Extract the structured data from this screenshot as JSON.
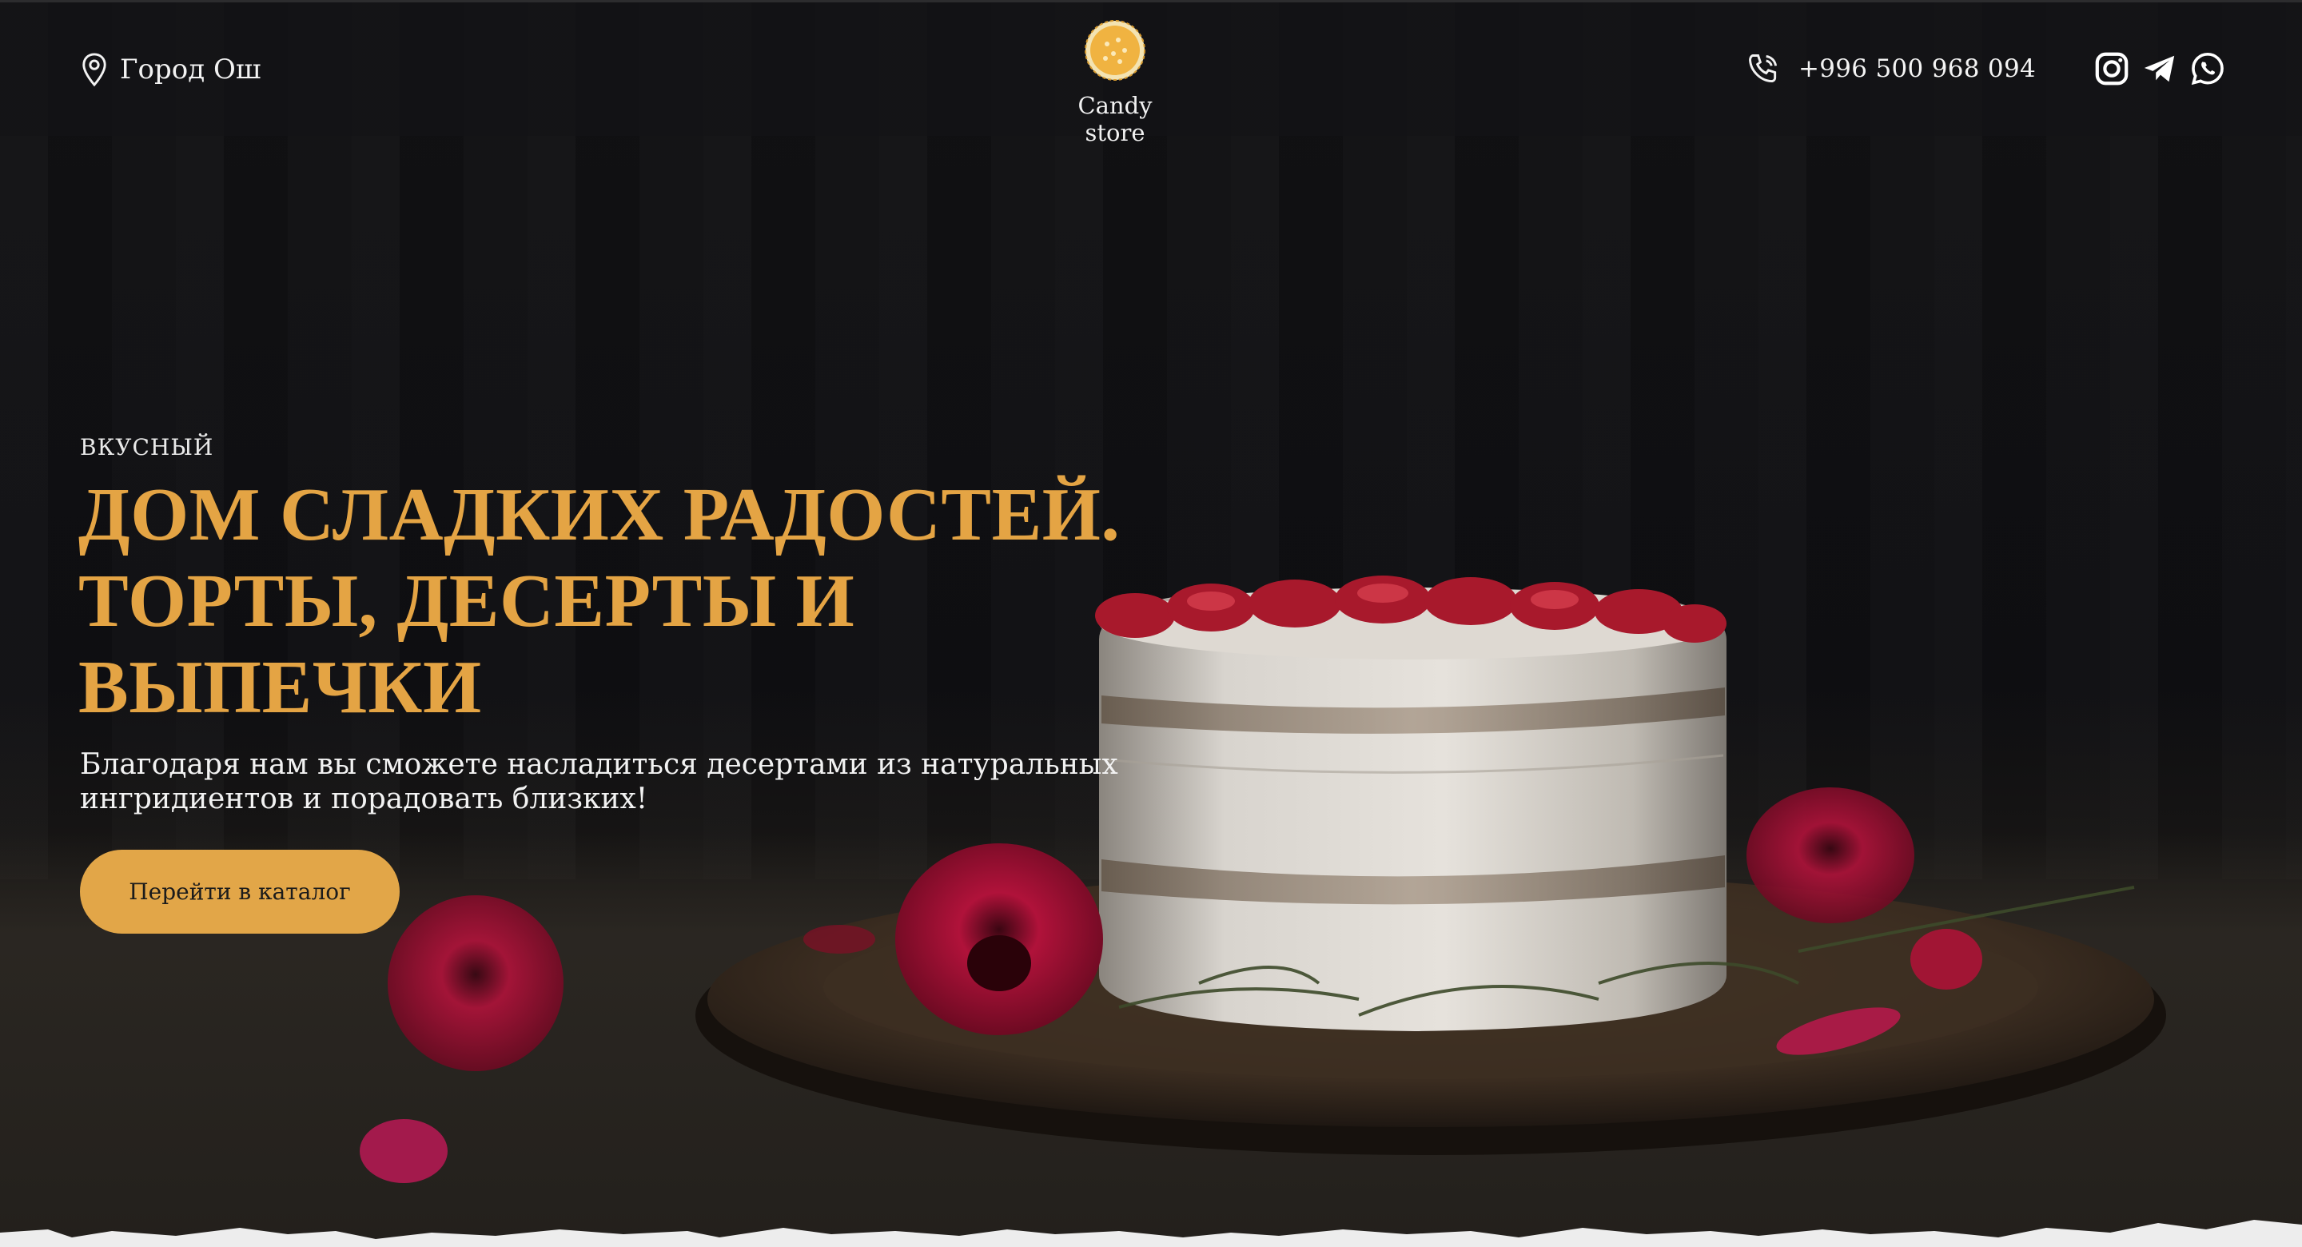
{
  "header": {
    "location_icon": "map-pin-icon",
    "city": "Город Ош",
    "logo_icon": "candy-store-logo",
    "brand": "Candy store",
    "phone_icon": "phone-icon",
    "phone": "+996 500 968 094",
    "social": [
      {
        "icon": "instagram-icon"
      },
      {
        "icon": "telegram-icon"
      },
      {
        "icon": "whatsapp-icon"
      }
    ]
  },
  "hero": {
    "kicker": "ВКУСНЫЙ",
    "title_lines": [
      "ДОМ СЛАДКИХ РАДОСТЕЙ.",
      "ТОРТЫ, ДЕСЕРТЫ И",
      "ВЫПЕЧКИ"
    ],
    "subtitle": "Благодаря нам вы сможете насладиться десертами из натуральных ингридиентов и порадовать близких!",
    "cta_label": "Перейти в каталог",
    "image": "cake-with-strawberries-and-roses"
  },
  "colors": {
    "accent": "#e2a648",
    "title": "#e4a444",
    "background": "#0e0e10"
  }
}
